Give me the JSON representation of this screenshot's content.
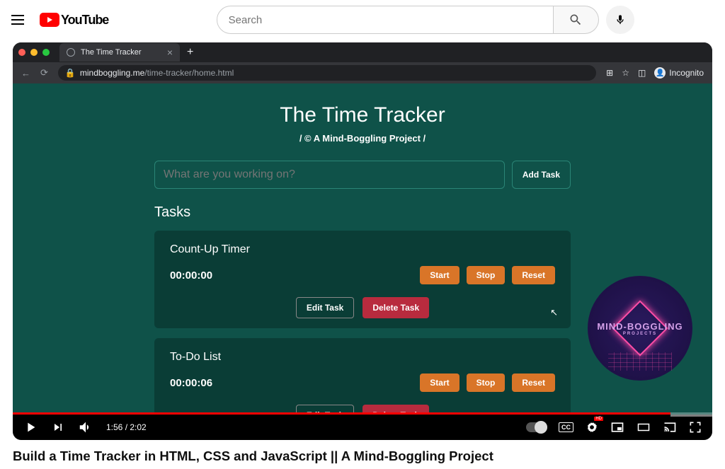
{
  "youtube": {
    "brand": "YouTube",
    "search_placeholder": "Search"
  },
  "browser": {
    "tab_title": "The Time Tracker",
    "url_domain": "mindboggling.me",
    "url_path": "/time-tracker/home.html",
    "mode": "Incognito"
  },
  "app": {
    "title": "The Time Tracker",
    "subtitle": "/ © A Mind-Boggling Project /",
    "input_placeholder": "What are you working on?",
    "add_label": "Add Task",
    "tasks_heading": "Tasks",
    "buttons": {
      "start": "Start",
      "stop": "Stop",
      "reset": "Reset",
      "edit": "Edit Task",
      "delete": "Delete Task"
    },
    "tasks": [
      {
        "name": "Count-Up Timer",
        "time": "00:00:00"
      },
      {
        "name": "To-Do List",
        "time": "00:00:06"
      }
    ],
    "watermark": {
      "line1": "MIND-BOGGLING",
      "line2": "PROJECTS"
    }
  },
  "player": {
    "current": "1:56",
    "duration": "2:02",
    "cc": "CC"
  },
  "video": {
    "title": "Build a Time Tracker in HTML, CSS and JavaScript || A Mind-Boggling Project"
  }
}
